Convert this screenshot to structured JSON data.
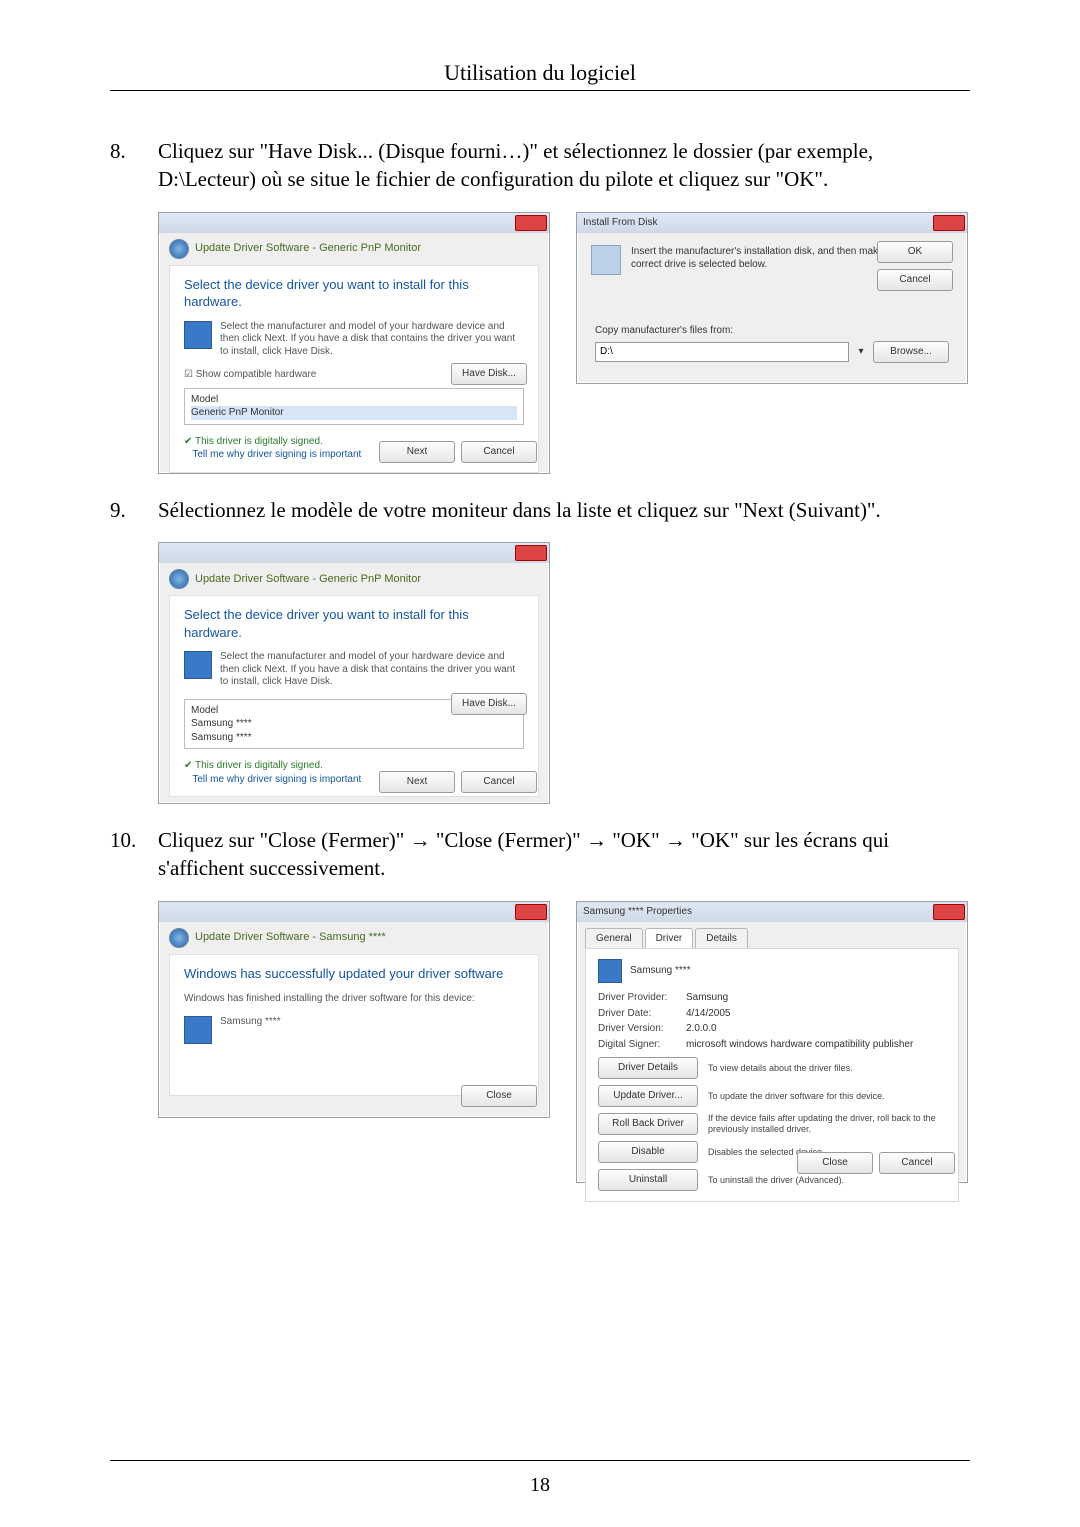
{
  "header": "Utilisation du logiciel",
  "page_number": "18",
  "steps": [
    {
      "num": "8.",
      "text": "Cliquez sur \"Have Disk... (Disque fourni…)\" et sélectionnez le dossier (par exemple, D:\\Lecteur) où se situe le fichier de configuration du pilote et cliquez sur \"OK\"."
    },
    {
      "num": "9.",
      "text": "Sélectionnez le modèle de votre moniteur dans la liste et cliquez sur \"Next (Suivant)\"."
    },
    {
      "num": "10.",
      "text": "Cliquez sur \"Close (Fermer)\" → \"Close (Fermer)\" → \"OK\" → \"OK\" sur les écrans qui s'affichent successivement."
    }
  ],
  "dlg_update1": {
    "crumb": "Update Driver Software - Generic PnP Monitor",
    "title": "Select the device driver you want to install for this hardware.",
    "hint": "Select the manufacturer and model of your hardware device and then click Next. If you have a disk that contains the driver you want to install, click Have Disk.",
    "show_compatible": "Show compatible hardware",
    "model_label": "Model",
    "model_item": "Generic PnP Monitor",
    "signed": "This driver is digitally signed.",
    "signed_link": "Tell me why driver signing is important",
    "have_disk": "Have Disk...",
    "next": "Next",
    "cancel": "Cancel"
  },
  "dlg_disk": {
    "title": "Install From Disk",
    "hint": "Insert the manufacturer's installation disk, and then make sure that the correct drive is selected below.",
    "copy_label": "Copy manufacturer's files from:",
    "path": "D:\\",
    "ok": "OK",
    "cancel": "Cancel",
    "browse": "Browse..."
  },
  "dlg_update2": {
    "crumb": "Update Driver Software - Generic PnP Monitor",
    "title": "Select the device driver you want to install for this hardware.",
    "hint": "Select the manufacturer and model of your hardware device and then click Next. If you have a disk that contains the driver you want to install, click Have Disk.",
    "model_label": "Model",
    "model_item1": "Samsung ****",
    "model_item2": "Samsung ****",
    "signed": "This driver is digitally signed.",
    "signed_link": "Tell me why driver signing is important",
    "have_disk": "Have Disk...",
    "next": "Next",
    "cancel": "Cancel"
  },
  "dlg_close": {
    "crumb": "Update Driver Software - Samsung ****",
    "title": "Windows has successfully updated your driver software",
    "sub": "Windows has finished installing the driver software for this device:",
    "device": "Samsung ****",
    "close": "Close"
  },
  "dlg_props": {
    "title": "Samsung **** Properties",
    "tabs": [
      "General",
      "Driver",
      "Details"
    ],
    "device": "Samsung ****",
    "kv": [
      [
        "Driver Provider:",
        "Samsung"
      ],
      [
        "Driver Date:",
        "4/14/2005"
      ],
      [
        "Driver Version:",
        "2.0.0.0"
      ],
      [
        "Digital Signer:",
        "microsoft windows hardware compatibility publisher"
      ]
    ],
    "actions": [
      [
        "Driver Details",
        "To view details about the driver files."
      ],
      [
        "Update Driver...",
        "To update the driver software for this device."
      ],
      [
        "Roll Back Driver",
        "If the device fails after updating the driver, roll back to the previously installed driver."
      ],
      [
        "Disable",
        "Disables the selected device."
      ],
      [
        "Uninstall",
        "To uninstall the driver (Advanced)."
      ]
    ],
    "close": "Close",
    "cancel": "Cancel"
  }
}
